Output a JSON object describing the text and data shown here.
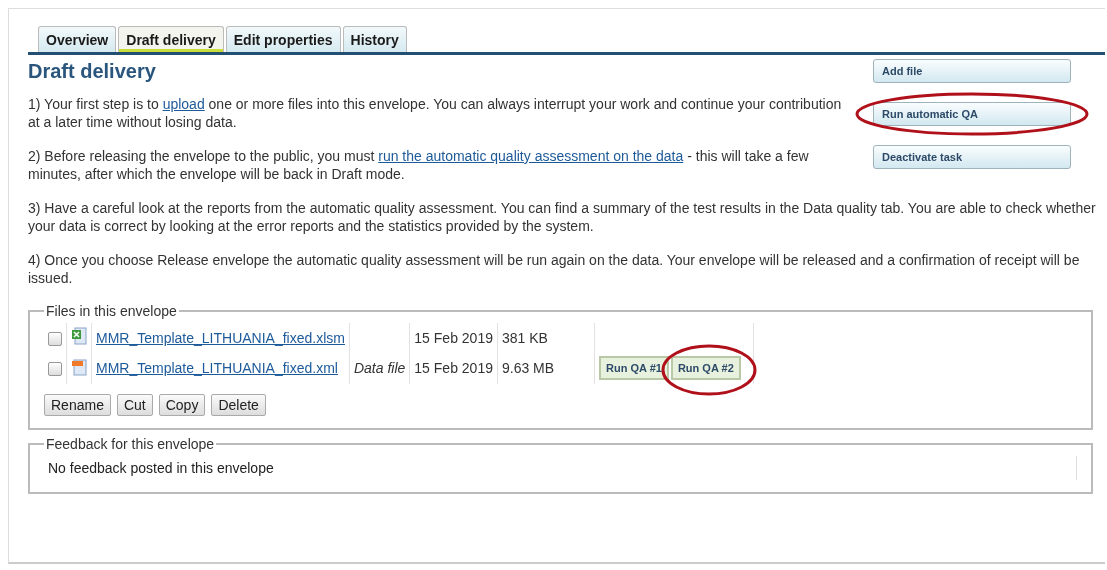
{
  "tabs": [
    {
      "label": "Overview",
      "selected": false
    },
    {
      "label": "Draft delivery",
      "selected": true
    },
    {
      "label": "Edit properties",
      "selected": false
    },
    {
      "label": "History",
      "selected": false
    }
  ],
  "heading": "Draft delivery",
  "actions": [
    {
      "label": "Add file",
      "highlighted": false
    },
    {
      "label": "Run automatic QA",
      "highlighted": true
    },
    {
      "label": "Deactivate task",
      "highlighted": false
    }
  ],
  "paragraphs": [
    {
      "parts": [
        {
          "text": "1) Your first step is to "
        },
        {
          "link": "upload"
        },
        {
          "text": " one or more files into this envelope. You can always interrupt your work and continue your contribution at a later time without losing data."
        }
      ]
    },
    {
      "parts": [
        {
          "text": "2) Before releasing the envelope to the public, you must "
        },
        {
          "link": "run the automatic quality assessment on the data"
        },
        {
          "text": " - this will take a few minutes, after which the envelope will be back in Draft mode."
        }
      ]
    },
    {
      "parts": [
        {
          "text": "3) Have a careful look at the reports from the automatic quality assessment. You can find a summary of the test results in the Data quality tab. You are able to check whether your data is correct by looking at the error reports and the statistics provided by the system."
        }
      ]
    },
    {
      "parts": [
        {
          "text": "4) Once you choose Release envelope the automatic quality assessment will be run again on the data. Your envelope will be released and a confirmation of receipt will be issued."
        }
      ]
    }
  ],
  "files": {
    "legend": "Files in this envelope",
    "rows": [
      {
        "checked": false,
        "kind": "spreadsheet",
        "name": "MMR_Template_LITHUANIA_fixed.xlsm",
        "date": "15 Feb 2019",
        "size": "381 KB",
        "buttons": []
      },
      {
        "checked": false,
        "kind": "xml",
        "name": "MMR_Template_LITHUANIA_fixed.xml",
        "description": "Data file",
        "date": "15 Feb 2019",
        "size": "9.63 MB",
        "buttons": [
          {
            "label": "Run QA #1",
            "highlighted": false
          },
          {
            "label": "Run QA #2",
            "highlighted": true
          }
        ]
      }
    ],
    "buttons": [
      "Rename",
      "Cut",
      "Copy",
      "Delete"
    ]
  },
  "feedback": {
    "legend": "Feedback for this envelope",
    "message": "No feedback posted in this envelope"
  }
}
